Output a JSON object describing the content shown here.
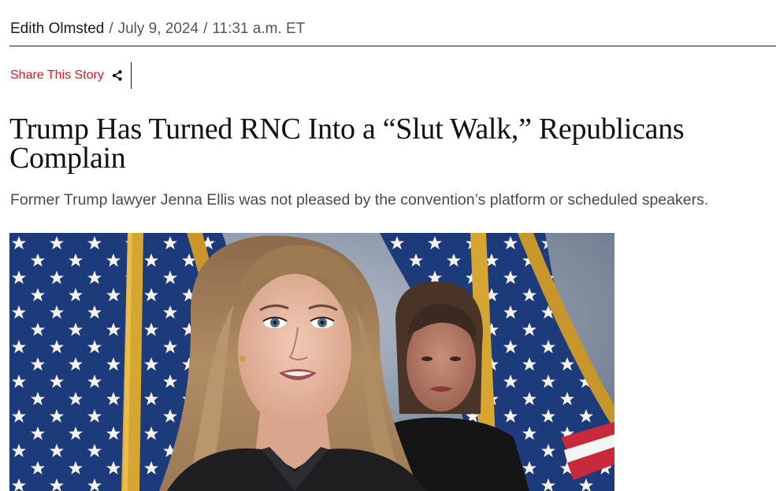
{
  "byline": {
    "author": "Edith Olmsted",
    "separator": "/",
    "date": "July 9, 2024",
    "time": "11:31 a.m. ET"
  },
  "share": {
    "label": "Share This Story",
    "icon": "share-icon"
  },
  "article": {
    "headline": "Trump Has Turned RNC Into a “Slut Walk,” Republicans Complain",
    "dek": "Former Trump lawyer Jenna Ellis was not pleased by the convention’s platform or scheduled speakers."
  },
  "colors": {
    "accent": "#e0191e",
    "text": "#111111",
    "muted": "#555555"
  }
}
